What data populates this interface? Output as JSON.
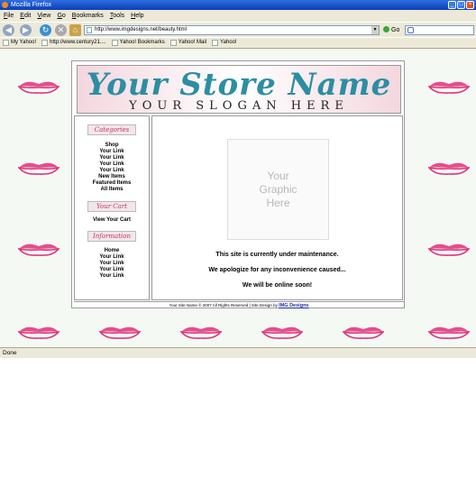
{
  "window": {
    "title": "Mozilla Firefox",
    "min_label": "_",
    "max_label": "□",
    "close_label": "×"
  },
  "menu": [
    "File",
    "Edit",
    "View",
    "Go",
    "Bookmarks",
    "Tools",
    "Help"
  ],
  "toolbar": {
    "back_icon": "back-arrow-icon",
    "forward_icon": "forward-arrow-icon",
    "reload_icon": "reload-icon",
    "stop_icon": "stop-icon",
    "home_icon": "home-icon",
    "go_label": "Go"
  },
  "address": {
    "url": "http://www.imgdesigns.net/beauty.html"
  },
  "bookmarks": [
    "My Yahoo!",
    "http://www.century21....",
    "Yahoo! Bookmarks",
    "Yahoo! Mail",
    "Yahoo!"
  ],
  "site": {
    "store_name": "Your Store Name",
    "slogan": "YOUR SLOGAN HERE",
    "categories_header": "Categories",
    "categories_links": [
      "Shop",
      "Your Link",
      "Your Link",
      "Your Link",
      "Your Link",
      "New Items",
      "Featured Items",
      "All Items"
    ],
    "cart_header": "Your Cart",
    "cart_link": "View Your Cart",
    "info_header": "Information",
    "info_links": [
      "Home",
      "Your Link",
      "Your Link",
      "Your Link",
      "Your Link"
    ],
    "graphic_line1": "Your",
    "graphic_line2": "Graphic",
    "graphic_line3": "Here",
    "maintenance_line1": "This site is currently under maintenance.",
    "maintenance_line2": "We apologize for any inconvenience caused...",
    "maintenance_line3": "We will be online soon!",
    "footer_text": "Your Site Name © 2007 All Rights Reserved  |  Site Design by",
    "footer_link": "IMG Designs"
  },
  "status": "Done",
  "colors": {
    "titlebar": "#0a3fb8",
    "chrome": "#ece9d8",
    "store_name": "#2c8ea3",
    "lips": "#e0307a",
    "background": "#f5f9f3"
  }
}
